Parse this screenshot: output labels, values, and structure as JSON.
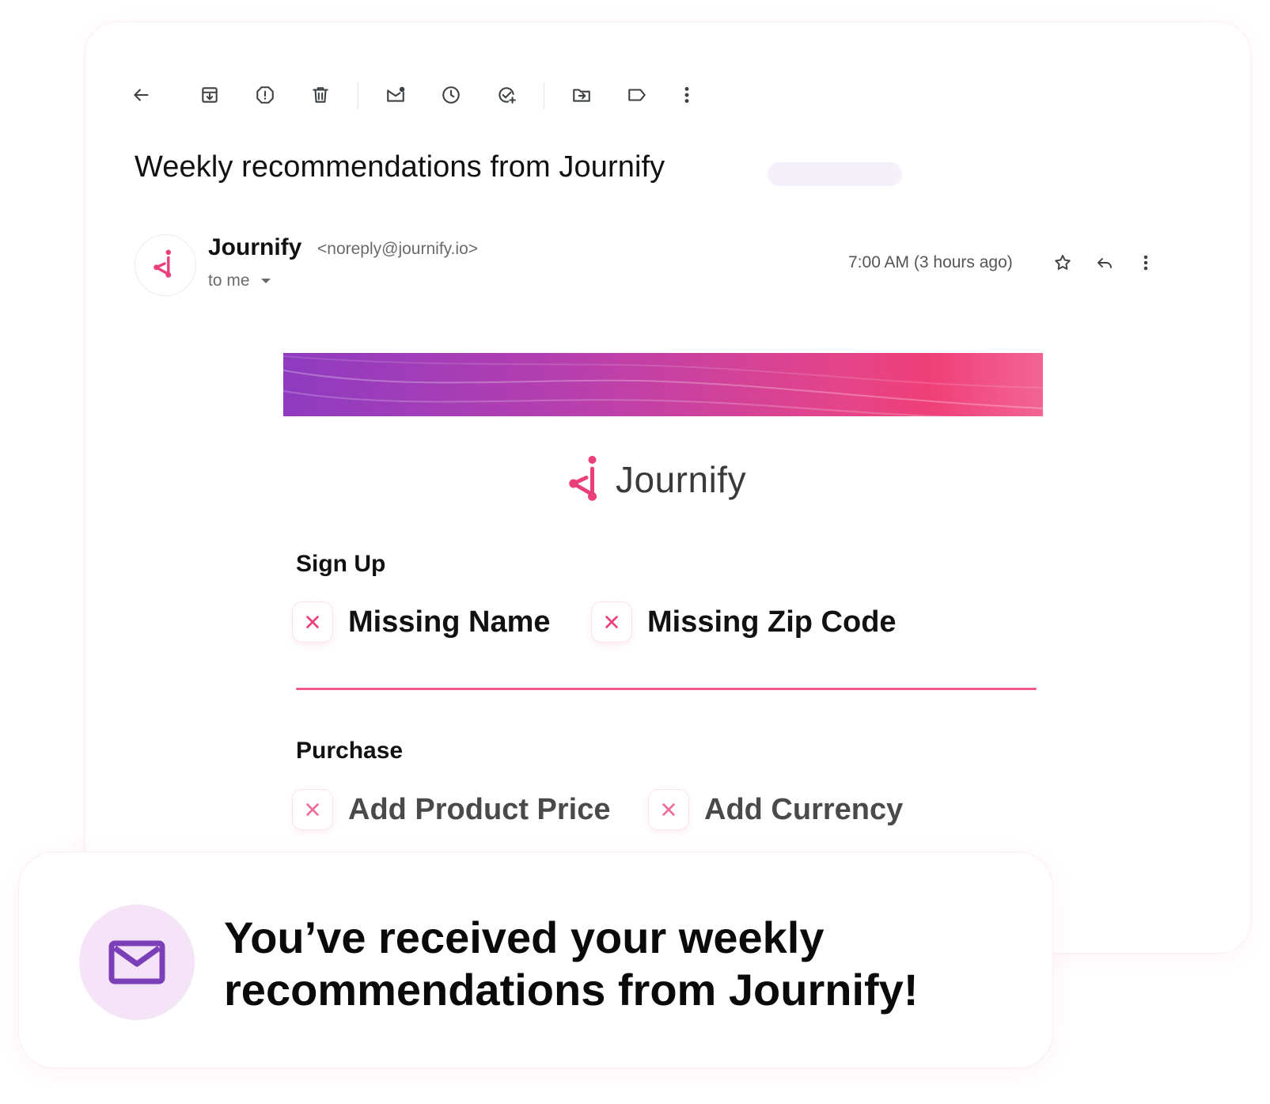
{
  "email": {
    "subject": "Weekly recommendations from Journify",
    "sender_name": "Journify",
    "sender_email": "<noreply@journify.io>",
    "recipient": "to me",
    "timestamp": "7:00 AM (3 hours ago)"
  },
  "toolbar": {
    "icons": [
      "back-arrow-icon",
      "archive-icon",
      "report-spam-icon",
      "delete-icon",
      "mark-unread-icon",
      "snooze-icon",
      "add-task-icon",
      "move-to-icon",
      "label-icon",
      "more-vert-icon"
    ]
  },
  "content": {
    "brand_name": "Journify",
    "sections": [
      {
        "title": "Sign Up",
        "items": [
          "Missing Name",
          "Missing Zip Code"
        ]
      },
      {
        "title": "Purchase",
        "items": [
          "Add Product Price",
          "Add Currency"
        ]
      }
    ]
  },
  "toast": {
    "message": "You’ve received your weekly recommendations from Journify!"
  },
  "colors": {
    "brand_pink": "#ea3f7a",
    "brand_purple": "#8e3bc0",
    "divider": "#ee5b8e",
    "mail_icon": "#7b3fb8",
    "mail_icon_bg": "#f5e3f7"
  }
}
